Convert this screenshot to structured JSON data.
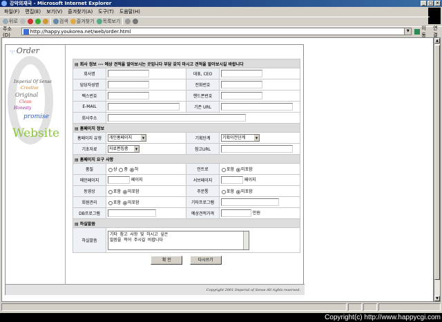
{
  "window": {
    "title": "강악의재국 - Microsoft Internet Explorer",
    "buttons": [
      "_",
      "□",
      "×"
    ]
  },
  "menu": [
    "파일(F)",
    "편집(E)",
    "보기(V)",
    "즐겨찾기(A)",
    "도구(T)",
    "도움말(H)"
  ],
  "toolbar": {
    "back": "뒤로",
    "search": "검색",
    "favorites": "즐겨찾기",
    "history": "목록보기"
  },
  "address": {
    "label": "주소(D)",
    "url": "http://happy.youkorea.net/web/order.html",
    "go": "이동",
    "links": "연결"
  },
  "logo": {
    "title": "Order",
    "imperial": "Imperial Of Sense",
    "creative": "Creative",
    "original": "Original",
    "clean": "Clean",
    "honesty": "Honesty",
    "promise": "promise",
    "website": "Website"
  },
  "sections": {
    "company": "회사 정보 --- 예상 견적을 알아보시는 곳입니다 부담 갖지 마시고 견적을 알아보시길 바랍니다",
    "homepage": "홈페이지 정보",
    "requirements": "홈페이지 요구 사항",
    "remarks": "하실말씀"
  },
  "company": {
    "name": "회사명",
    "ceo": "대표, CEO",
    "contact": "담당자성명",
    "phone": "전화번호",
    "fax": "팩스번호",
    "mobile": "핸드폰번호",
    "email": "E-MAIL",
    "existing_url": "기존 URL",
    "address": "회사주소"
  },
  "homepage": {
    "type_label": "홈페이지 유형",
    "type_value": "개인홈페이지",
    "stage_label": "기획단계",
    "stage_value": "기획이전단계",
    "material_label": "기초자료",
    "material_value": "자료편집중",
    "ref_label": "참고URL"
  },
  "req": {
    "quality": "품질",
    "high": "상",
    "mid": "중",
    "low": "하",
    "intro": "인트로",
    "include": "포함",
    "exclude": "미포함",
    "main_page": "메인페이지",
    "page_unit": "페이지",
    "sub_page": "서브페이지",
    "video": "동영상",
    "order_system": "주문통",
    "member": "회원관리",
    "other": "기타프로그램",
    "db": "DB프로그램",
    "budget": "예상견적가격",
    "won": "만원"
  },
  "remarks": {
    "label": "하실말씀",
    "text": "기타 참고 사항 및 하시고 싶은\n말씀을 적어 주시길 바랍니다"
  },
  "buttons": {
    "submit": "확    인",
    "reset": "다시쓰기"
  },
  "footer": {
    "copyright": "Copyright 2001 Imperial of Sense All rights reserved."
  },
  "watermark": "Copyright(c) http://www.happycgi.com"
}
